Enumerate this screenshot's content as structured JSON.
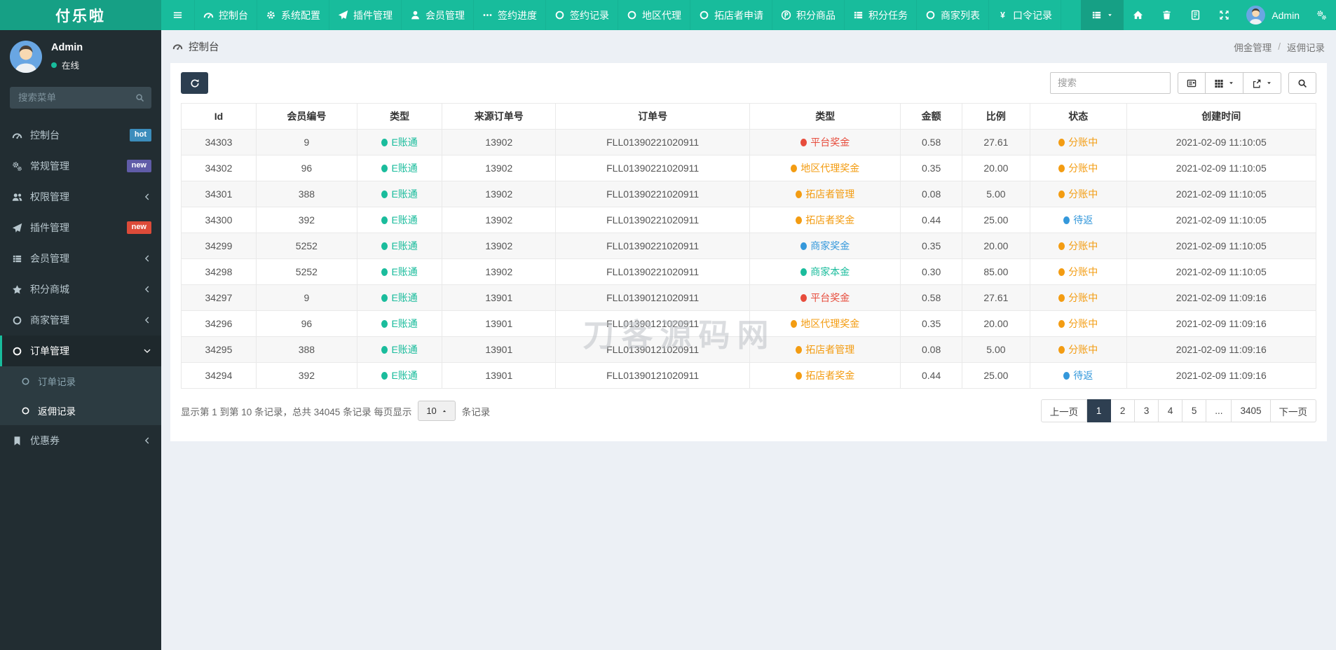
{
  "brand": "付乐啦",
  "topnav": {
    "items": [
      {
        "name": "topnav-item-dashboard",
        "label": "控制台",
        "icon": "dashboard-icon"
      },
      {
        "name": "topnav-item-system-config",
        "label": "系统配置",
        "icon": "gear-icon"
      },
      {
        "name": "topnav-item-plugin",
        "label": "插件管理",
        "icon": "paper-plane-icon"
      },
      {
        "name": "topnav-item-member",
        "label": "会员管理",
        "icon": "user-icon"
      },
      {
        "name": "topnav-item-sign-progress",
        "label": "签约进度",
        "icon": "ellipsis-icon"
      },
      {
        "name": "topnav-item-sign-records",
        "label": "签约记录",
        "icon": "circle-icon"
      },
      {
        "name": "topnav-item-region-agent",
        "label": "地区代理",
        "icon": "circle-icon"
      },
      {
        "name": "topnav-item-shop-developer-apply",
        "label": "拓店者申请",
        "icon": "circle-icon"
      },
      {
        "name": "topnav-item-points-goods",
        "label": "积分商品",
        "icon": "product-icon"
      },
      {
        "name": "topnav-item-points-tasks",
        "label": "积分任务",
        "icon": "list-icon"
      },
      {
        "name": "topnav-item-merchant-list",
        "label": "商家列表",
        "icon": "circle-icon"
      },
      {
        "name": "topnav-item-password-records",
        "label": "口令记录",
        "icon": "yen-icon"
      }
    ],
    "quick_actions": [
      {
        "name": "home-button",
        "icon": "home-icon"
      },
      {
        "name": "trash-button",
        "icon": "trash-icon"
      },
      {
        "name": "log-button",
        "icon": "log-icon"
      },
      {
        "name": "fullscreen-button",
        "icon": "expand-icon"
      }
    ],
    "user": {
      "name": "Admin"
    }
  },
  "sidebar": {
    "user": {
      "name": "Admin",
      "status": "在线"
    },
    "search_placeholder": "搜索菜单",
    "items": [
      {
        "name": "sidebar-item-dashboard",
        "label": "控制台",
        "icon": "dashboard-icon",
        "badge": {
          "text": "hot",
          "color": "blue"
        }
      },
      {
        "name": "sidebar-item-general",
        "label": "常规管理",
        "icon": "gears-icon",
        "badge": {
          "text": "new",
          "color": "purple"
        }
      },
      {
        "name": "sidebar-item-permission",
        "label": "权限管理",
        "icon": "users-icon",
        "chevron": "chevron-left-icon"
      },
      {
        "name": "sidebar-item-plugin",
        "label": "插件管理",
        "icon": "paper-plane-icon",
        "badge": {
          "text": "new",
          "color": "red"
        }
      },
      {
        "name": "sidebar-item-member",
        "label": "会员管理",
        "icon": "list-icon",
        "chevron": "chevron-left-icon"
      },
      {
        "name": "sidebar-item-points-mall",
        "label": "积分商城",
        "icon": "star-icon",
        "chevron": "chevron-left-icon"
      },
      {
        "name": "sidebar-item-merchant",
        "label": "商家管理",
        "icon": "circle-icon",
        "chevron": "chevron-left-icon"
      },
      {
        "name": "sidebar-item-order",
        "label": "订单管理",
        "icon": "circle-icon",
        "chevron": "chevron-down-icon",
        "active": true,
        "sub": [
          {
            "name": "sidebar-subitem-order-records",
            "label": "订单记录",
            "active": false
          },
          {
            "name": "sidebar-subitem-rebate-records",
            "label": "返佣记录",
            "active": true
          }
        ]
      },
      {
        "name": "sidebar-item-coupon",
        "label": "优惠券",
        "icon": "bookmark-icon",
        "chevron": "chevron-left-icon"
      }
    ]
  },
  "breadcrumb": {
    "left": "控制台",
    "parent": "佣金管理",
    "separator": "/",
    "current": "返佣记录"
  },
  "toolbar": {
    "refresh_icon": "refresh-icon",
    "search_placeholder": "搜索",
    "search_icon": "search-icon",
    "view_buttons": [
      {
        "name": "toggle-view-button",
        "icon": "detail-icon",
        "caret": false
      },
      {
        "name": "columns-button",
        "icon": "columns-icon",
        "caret": true
      },
      {
        "name": "export-button",
        "icon": "export-icon",
        "caret": true
      }
    ]
  },
  "table": {
    "columns": [
      "Id",
      "会员编号",
      "类型",
      "来源订单号",
      "订单号",
      "类型",
      "金额",
      "比例",
      "状态",
      "创建时间"
    ],
    "rows": [
      {
        "id": "34303",
        "member_no": "9",
        "account_type": {
          "label": "E账通",
          "color": "teal"
        },
        "source_order_no": "13902",
        "order_no": "FLL01390221020911",
        "reward_type": {
          "label": "平台奖金",
          "color": "red"
        },
        "amount": "0.58",
        "ratio": "27.61",
        "status": {
          "label": "分账中",
          "color": "orange"
        },
        "created_at": "2021-02-09 11:10:05"
      },
      {
        "id": "34302",
        "member_no": "96",
        "account_type": {
          "label": "E账通",
          "color": "teal"
        },
        "source_order_no": "13902",
        "order_no": "FLL01390221020911",
        "reward_type": {
          "label": "地区代理奖金",
          "color": "orange"
        },
        "amount": "0.35",
        "ratio": "20.00",
        "status": {
          "label": "分账中",
          "color": "orange"
        },
        "created_at": "2021-02-09 11:10:05"
      },
      {
        "id": "34301",
        "member_no": "388",
        "account_type": {
          "label": "E账通",
          "color": "teal"
        },
        "source_order_no": "13902",
        "order_no": "FLL01390221020911",
        "reward_type": {
          "label": "拓店者管理",
          "color": "orange"
        },
        "amount": "0.08",
        "ratio": "5.00",
        "status": {
          "label": "分账中",
          "color": "orange"
        },
        "created_at": "2021-02-09 11:10:05"
      },
      {
        "id": "34300",
        "member_no": "392",
        "account_type": {
          "label": "E账通",
          "color": "teal"
        },
        "source_order_no": "13902",
        "order_no": "FLL01390221020911",
        "reward_type": {
          "label": "拓店者奖金",
          "color": "orange"
        },
        "amount": "0.44",
        "ratio": "25.00",
        "status": {
          "label": "待返",
          "color": "blue"
        },
        "created_at": "2021-02-09 11:10:05"
      },
      {
        "id": "34299",
        "member_no": "5252",
        "account_type": {
          "label": "E账通",
          "color": "teal"
        },
        "source_order_no": "13902",
        "order_no": "FLL01390221020911",
        "reward_type": {
          "label": "商家奖金",
          "color": "blue"
        },
        "amount": "0.35",
        "ratio": "20.00",
        "status": {
          "label": "分账中",
          "color": "orange"
        },
        "created_at": "2021-02-09 11:10:05"
      },
      {
        "id": "34298",
        "member_no": "5252",
        "account_type": {
          "label": "E账通",
          "color": "teal"
        },
        "source_order_no": "13902",
        "order_no": "FLL01390221020911",
        "reward_type": {
          "label": "商家本金",
          "color": "teal"
        },
        "amount": "0.30",
        "ratio": "85.00",
        "status": {
          "label": "分账中",
          "color": "orange"
        },
        "created_at": "2021-02-09 11:10:05"
      },
      {
        "id": "34297",
        "member_no": "9",
        "account_type": {
          "label": "E账通",
          "color": "teal"
        },
        "source_order_no": "13901",
        "order_no": "FLL01390121020911",
        "reward_type": {
          "label": "平台奖金",
          "color": "red"
        },
        "amount": "0.58",
        "ratio": "27.61",
        "status": {
          "label": "分账中",
          "color": "orange"
        },
        "created_at": "2021-02-09 11:09:16"
      },
      {
        "id": "34296",
        "member_no": "96",
        "account_type": {
          "label": "E账通",
          "color": "teal"
        },
        "source_order_no": "13901",
        "order_no": "FLL01390121020911",
        "reward_type": {
          "label": "地区代理奖金",
          "color": "orange"
        },
        "amount": "0.35",
        "ratio": "20.00",
        "status": {
          "label": "分账中",
          "color": "orange"
        },
        "created_at": "2021-02-09 11:09:16"
      },
      {
        "id": "34295",
        "member_no": "388",
        "account_type": {
          "label": "E账通",
          "color": "teal"
        },
        "source_order_no": "13901",
        "order_no": "FLL01390121020911",
        "reward_type": {
          "label": "拓店者管理",
          "color": "orange"
        },
        "amount": "0.08",
        "ratio": "5.00",
        "status": {
          "label": "分账中",
          "color": "orange"
        },
        "created_at": "2021-02-09 11:09:16"
      },
      {
        "id": "34294",
        "member_no": "392",
        "account_type": {
          "label": "E账通",
          "color": "teal"
        },
        "source_order_no": "13901",
        "order_no": "FLL01390121020911",
        "reward_type": {
          "label": "拓店者奖金",
          "color": "orange"
        },
        "amount": "0.44",
        "ratio": "25.00",
        "status": {
          "label": "待返",
          "color": "blue"
        },
        "created_at": "2021-02-09 11:09:16"
      }
    ]
  },
  "watermark": "刀客源码网",
  "footer": {
    "summary_before": "显示第 1 到第 10 条记录，总共 34045 条记录 每页显示",
    "page_size": "10",
    "summary_after": "条记录",
    "pages": [
      {
        "label": "上一页",
        "active": false
      },
      {
        "label": "1",
        "active": true
      },
      {
        "label": "2",
        "active": false
      },
      {
        "label": "3",
        "active": false
      },
      {
        "label": "4",
        "active": false
      },
      {
        "label": "5",
        "active": false
      },
      {
        "label": "...",
        "active": false
      },
      {
        "label": "3405",
        "active": false
      },
      {
        "label": "下一页",
        "active": false
      }
    ]
  },
  "colors": {
    "navbar": "#18bc9c",
    "brand_bg": "#16a085",
    "sidebar_bg": "#222d32",
    "submenu_bg": "#2c3b41",
    "accent": "#18bc9c",
    "dark_button": "#2c3e50",
    "content_bg": "#ecf0f5",
    "status_red": "#e74c3c",
    "status_orange": "#f39c12",
    "status_blue": "#3498db",
    "status_teal": "#1abc9c",
    "badge_blue": "#3c8dbc",
    "badge_purple": "#605ca8",
    "badge_red": "#dd4b39"
  }
}
